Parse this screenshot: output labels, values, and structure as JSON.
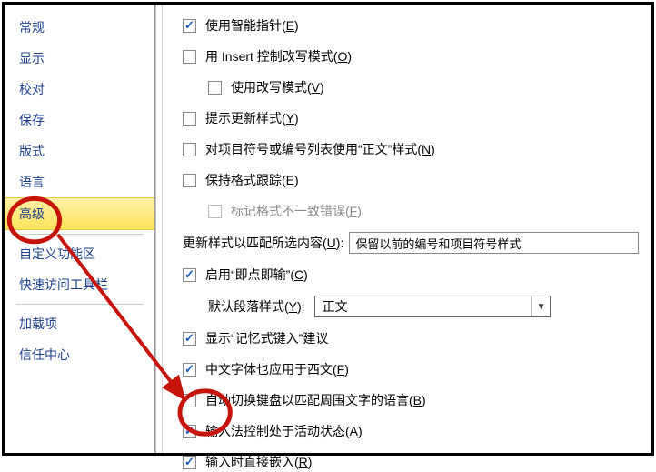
{
  "sidebar": {
    "items": [
      {
        "label": "常规"
      },
      {
        "label": "显示"
      },
      {
        "label": "校对"
      },
      {
        "label": "保存"
      },
      {
        "label": "版式"
      },
      {
        "label": "语言"
      },
      {
        "label": "高级"
      },
      {
        "label": "自定义功能区"
      },
      {
        "label": "快速访问工具栏"
      },
      {
        "label": "加载项"
      },
      {
        "label": "信任中心"
      }
    ],
    "selected_index": 6
  },
  "options": {
    "smart_pointer": {
      "checked": true,
      "label": "使用智能指针",
      "mn": "E"
    },
    "insert_overwrite": {
      "checked": false,
      "label": "用 Insert 控制改写模式",
      "mn": "O"
    },
    "use_overwrite": {
      "checked": false,
      "label": "使用改写模式",
      "mn": "V"
    },
    "prompt_update_style": {
      "checked": false,
      "label": "提示更新样式",
      "mn": "Y"
    },
    "bullet_normal_style": {
      "checked": false,
      "label": "对项目符号或编号列表使用“正文”样式",
      "mn": "N"
    },
    "keep_format_track": {
      "checked": false,
      "label": "保持格式跟踪",
      "mn": "E"
    },
    "mark_format_inconsistency": {
      "checked": false,
      "label": "标记格式不一致错误",
      "mn": "F"
    },
    "update_style_label": "更新样式以匹配所选内容",
    "update_style_mn": "U",
    "update_style_value": "保留以前的编号和项目符号样式",
    "enable_click_type": {
      "checked": true,
      "label": "启用“即点即输”",
      "mn": "C"
    },
    "default_para_style_label": "默认段落样式",
    "default_para_style_mn": "Y",
    "default_para_style_value": "正文",
    "show_memory_ime": {
      "checked": true,
      "label": "显示“记忆式键入”建议"
    },
    "cjk_font_western": {
      "checked": true,
      "label": "中文字体也应用于西文",
      "mn": "F"
    },
    "auto_switch_kb": {
      "checked": false,
      "label": "自动切换键盘以匹配周围文字的语言",
      "mn": "B"
    },
    "ime_active": {
      "checked": true,
      "label": "输入法控制处于活动状态",
      "mn": "A"
    },
    "ime_inline": {
      "checked": true,
      "label": "输入时直接嵌入",
      "mn": "R"
    }
  }
}
